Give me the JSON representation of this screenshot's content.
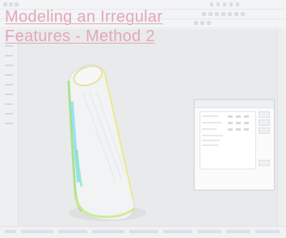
{
  "slide": {
    "title_line1": "Modeling an Irregular",
    "title_line2": "Features - Method 2",
    "title_color": "#e2a8b7"
  },
  "app": {
    "viewport_bg": "#e9eaec",
    "model": {
      "shape": "tilted cylinder with flared base",
      "stripe_colors": [
        "#9fe07a",
        "#7ad9f0",
        "#f0e97a"
      ]
    }
  },
  "icons": {
    "toolbar": "toolbar-button-icon",
    "sidebar": "tree-item-icon"
  }
}
